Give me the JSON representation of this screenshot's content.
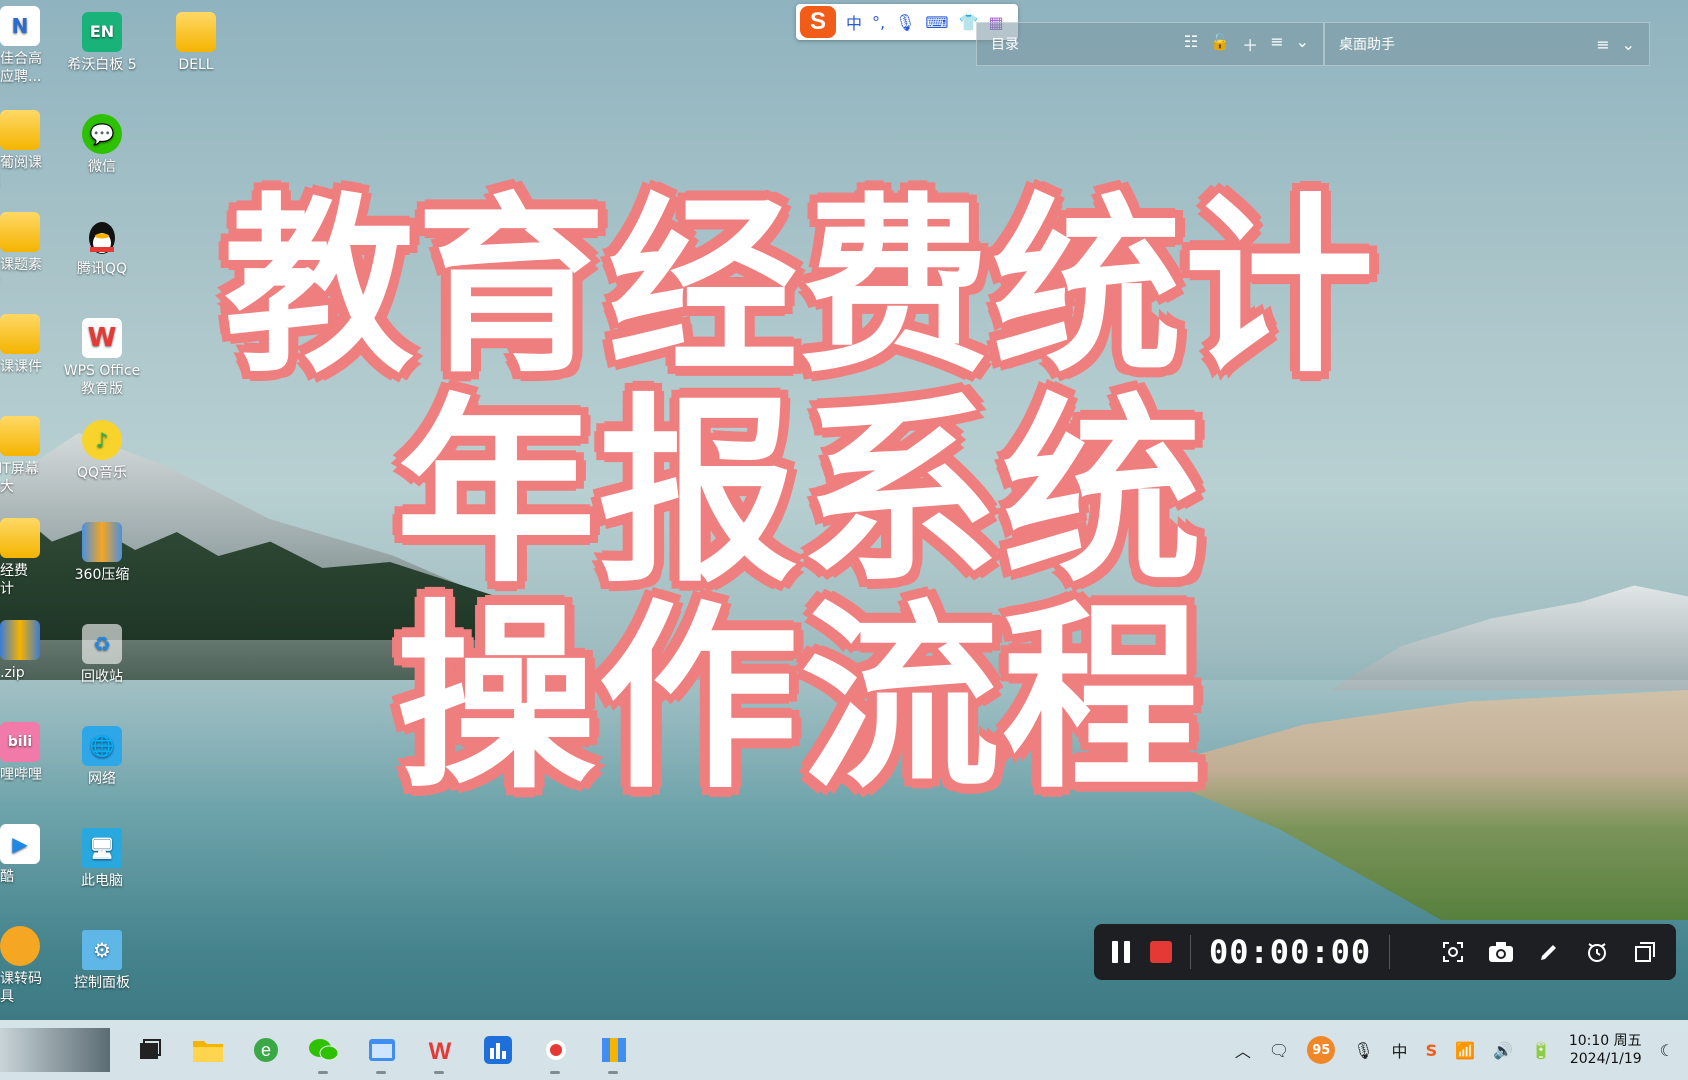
{
  "desktop_icons_col1": [
    {
      "label": "课佳合高\n学应聘...",
      "icon": "doc-icon"
    },
    {
      "label": "爱葡阅课\n题",
      "icon": "folder-icon"
    },
    {
      "label": "训课题素\n材",
      "icon": "folder-icon"
    },
    {
      "label": "明课课件",
      "icon": "folder-icon"
    },
    {
      "label": "MIT屏幕\n放大",
      "icon": "folder-icon"
    },
    {
      "label": "年经费\n统计",
      "icon": "folder-icon"
    },
    {
      "label": "文.zip",
      "icon": "zip-icon"
    },
    {
      "label": "哔哩哔哩",
      "icon": "bilibili-icon"
    },
    {
      "label": "优酷",
      "icon": "youku-icon"
    },
    {
      "label": "一课转码\n工具",
      "icon": "converter-icon"
    }
  ],
  "desktop_icons_col2": [
    {
      "label": "希沃白板 5",
      "icon": "whiteboard-icon",
      "glyph": "EN"
    },
    {
      "label": "微信",
      "icon": "wechat-icon"
    },
    {
      "label": "腾讯QQ",
      "icon": "qq-icon"
    },
    {
      "label": "WPS Office\n教育版",
      "icon": "wps-icon",
      "glyph": "W"
    },
    {
      "label": "QQ音乐",
      "icon": "qq-music-icon"
    },
    {
      "label": "360压缩",
      "icon": "compress-icon"
    },
    {
      "label": "回收站",
      "icon": "recycle-bin-icon"
    },
    {
      "label": "网络",
      "icon": "network-icon"
    },
    {
      "label": "此电脑",
      "icon": "this-pc-icon"
    },
    {
      "label": "控制面板",
      "icon": "control-panel-icon"
    }
  ],
  "desktop_icons_col3": [
    {
      "label": "DELL",
      "icon": "folder-icon"
    }
  ],
  "ime_bar": {
    "logo": "S",
    "mode": "中",
    "punct": "°,",
    "mic": "🎙",
    "keyboard": "⌨",
    "skin": "👕",
    "apps": "▦"
  },
  "panel_left": {
    "title": "目录"
  },
  "panel_right": {
    "title": "桌面助手"
  },
  "title_lines": [
    "教育经费统计",
    "年报系统",
    "操作流程"
  ],
  "recorder": {
    "timer": "00:00:00"
  },
  "taskbar": {
    "tray_badge": "95",
    "ime_lang": "中",
    "time": "10:10 周五",
    "date": "2024/1/19"
  },
  "colors": {
    "title_outline": "#ef7f7f",
    "recorder_bg": "#1e1f22",
    "stop_red": "#e53935",
    "ime_orange": "#f25c19"
  }
}
